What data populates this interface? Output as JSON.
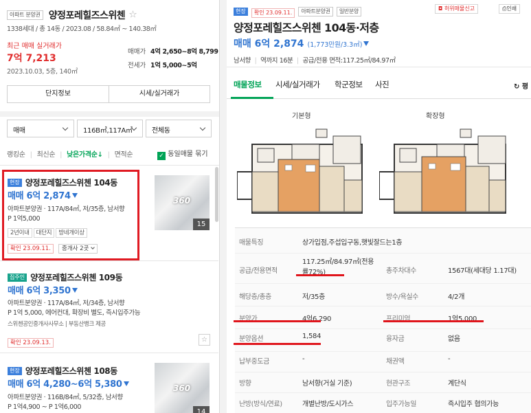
{
  "complex": {
    "type_tag": "아파트 분양권",
    "name": "양정포레힐즈스위첸",
    "summary": "1338세대 / 총 14동 / 2023.08 / 58.84㎡ ~ 140.38㎡",
    "recent_label": "최근 매매 실거래가",
    "recent_price": "7억 7,213",
    "recent_detail": "2023.10.03, 5층, 140㎡",
    "sale_label": "매매가",
    "sale_range": "4억 2,650~8억 8,799",
    "jeonse_label": "전세가",
    "jeonse_range": "1억 5,000~5억",
    "btn_info": "단지정보",
    "btn_price": "시세/실거래가"
  },
  "filters": {
    "deal": "매매",
    "area": "116B㎡,117A㎡",
    "dong": "전체동"
  },
  "sort": {
    "items": [
      "랭킹순",
      "최신순",
      "낮은가격순",
      "면적순"
    ],
    "active_arrow": "↓",
    "same_label": "동일매물 묶기"
  },
  "listings": [
    {
      "badge": "현장",
      "title": "양정포레힐즈스위첸 104동",
      "price": "매매 6억 2,874",
      "detail": "아파트분양권 · 117A/84㎡, 저/35층, 남서향",
      "premium": "P 1억5,000",
      "chips": [
        "2년이내",
        "대단지",
        "방네개이상"
      ],
      "confirm": "확인 23.09.11.",
      "agent": "중개사 2곳",
      "photo_count": "15",
      "vr": "360"
    },
    {
      "badge": "집주인",
      "title": "양정포레힐즈스위첸 109동",
      "price": "매매 6억 3,350",
      "detail": "아파트분양권 · 117A/84㎡, 저/34층, 남서향",
      "premium": "P 1억 5,000, 에어컨대, 확장비 별도, 즉시입주가능",
      "source": "스위첸공인중개사사무소 | 부동산뱅크 제공",
      "confirm": "확인 23.09.13."
    },
    {
      "badge": "현장",
      "title": "양정포레힐즈스위첸 108동",
      "price": "매매 6억 4,280~6억 5,380",
      "detail": "아파트분양권 · 116B/84㎡, 5/32층, 남서향",
      "premium": "P 1억4,900 ~ P 1억6,000",
      "photo_count": "14",
      "vr": "360"
    }
  ],
  "detail": {
    "badge": "현장",
    "confirm": "확인 23.09.11.",
    "type_tag": "아파트분양권",
    "sale_tag": "일반분양",
    "report": "허위매물신고",
    "print": "인쇄",
    "title": "양정포레힐즈스위첸 104동·저층",
    "price": "매매 6억 2,874",
    "unit_price": "(1,773만원/3.3㎡)",
    "sub_direction": "남서향",
    "sub_station": "역까지 16분",
    "sub_area": "공급/전용 면적:117.25㎡/84.97㎡",
    "tabs": [
      "매물정보",
      "시세/실거래가",
      "학군정보",
      "사진"
    ],
    "tab_right": "평",
    "plan_basic": "기본형",
    "plan_expand": "확장형",
    "rows": [
      {
        "l1": "매물특징",
        "v1": "상가입점,주섭입구동,햇빛잘드는1층",
        "l2": "",
        "v2": ""
      },
      {
        "l1": "공급/전용면적",
        "v1": "117.25㎡/84.97㎡(전용률72%)",
        "l2": "총주차대수",
        "v2": "1567대(세대당 1.17대)"
      },
      {
        "l1": "해당층/총층",
        "v1": "저/35층",
        "l2": "방수/욕실수",
        "v2": "4/2개"
      },
      {
        "l1": "분양가",
        "v1": "4억6,290",
        "l2": "프리미엄",
        "v2": "1억5,000"
      },
      {
        "l1": "분양옵션",
        "v1": "1,584",
        "l2": "융자금",
        "v2": "없음"
      },
      {
        "l1": "납부중도금",
        "v1": "-",
        "l2": "채권액",
        "v2": "-"
      },
      {
        "l1": "방향",
        "v1": "남서향(거실 기준)",
        "l2": "현관구조",
        "v2": "계단식"
      },
      {
        "l1": "난방(방식/연료)",
        "v1": "개별난방/도시가스",
        "l2": "입주가능일",
        "v2": "즉시입주 협의가능"
      }
    ]
  },
  "colors": {
    "accent_red": "#e02c2c",
    "price_blue": "#2f74d0",
    "tab_green": "#00a356",
    "highlight_red": "#e0141b"
  }
}
